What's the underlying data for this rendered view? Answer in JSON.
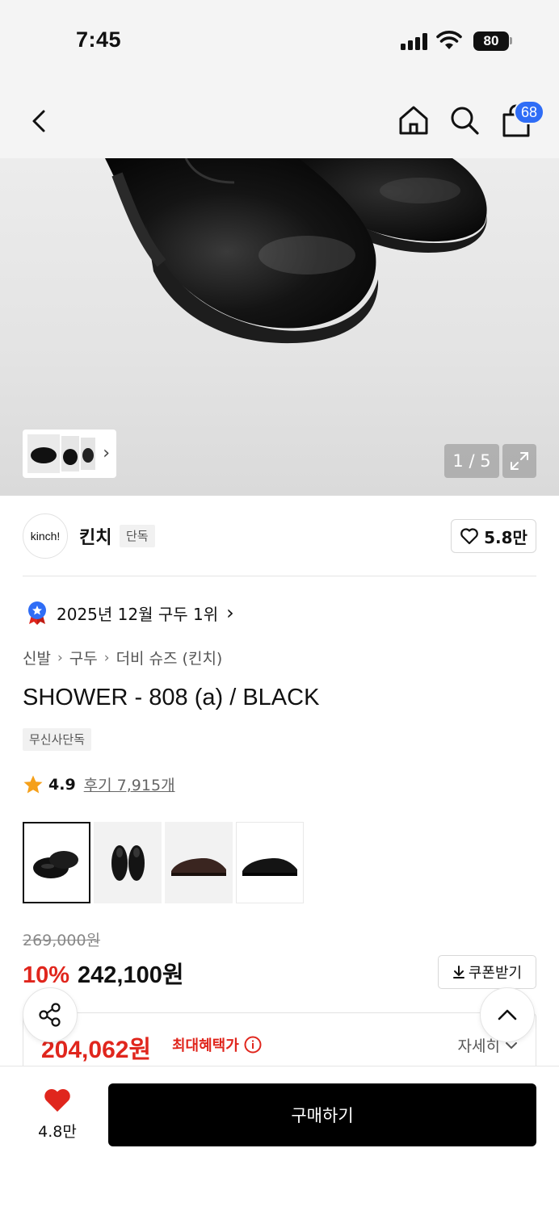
{
  "status": {
    "time": "7:45",
    "battery": "80"
  },
  "nav": {
    "cart_count": "68"
  },
  "gallery": {
    "counter": "1 / 5"
  },
  "brand": {
    "logo_text": "kinch!",
    "name": "킨치",
    "tag": "단독",
    "likes": "5.8만"
  },
  "rank": {
    "text": "2025년 12월 구두 1위"
  },
  "breadcrumb": [
    "신발",
    "구두",
    "더비 슈즈 (킨치)"
  ],
  "product": {
    "title": "SHOWER - 808 (a) / BLACK",
    "exclusive_tag": "무신사단독",
    "rating": "4.9",
    "reviews": "후기 7,915개"
  },
  "pricing": {
    "original": "269,000원",
    "discount": "10%",
    "price": "242,100원",
    "coupon_label": "쿠폰받기",
    "benefit_price": "204,062원",
    "benefit_label": "최대혜택가",
    "detail_label": "자세히"
  },
  "bottom": {
    "wish_count": "4.8만",
    "buy_label": "구매하기"
  },
  "colors": {
    "accent_red": "#e0261d",
    "badge_blue": "#2f6df6"
  }
}
